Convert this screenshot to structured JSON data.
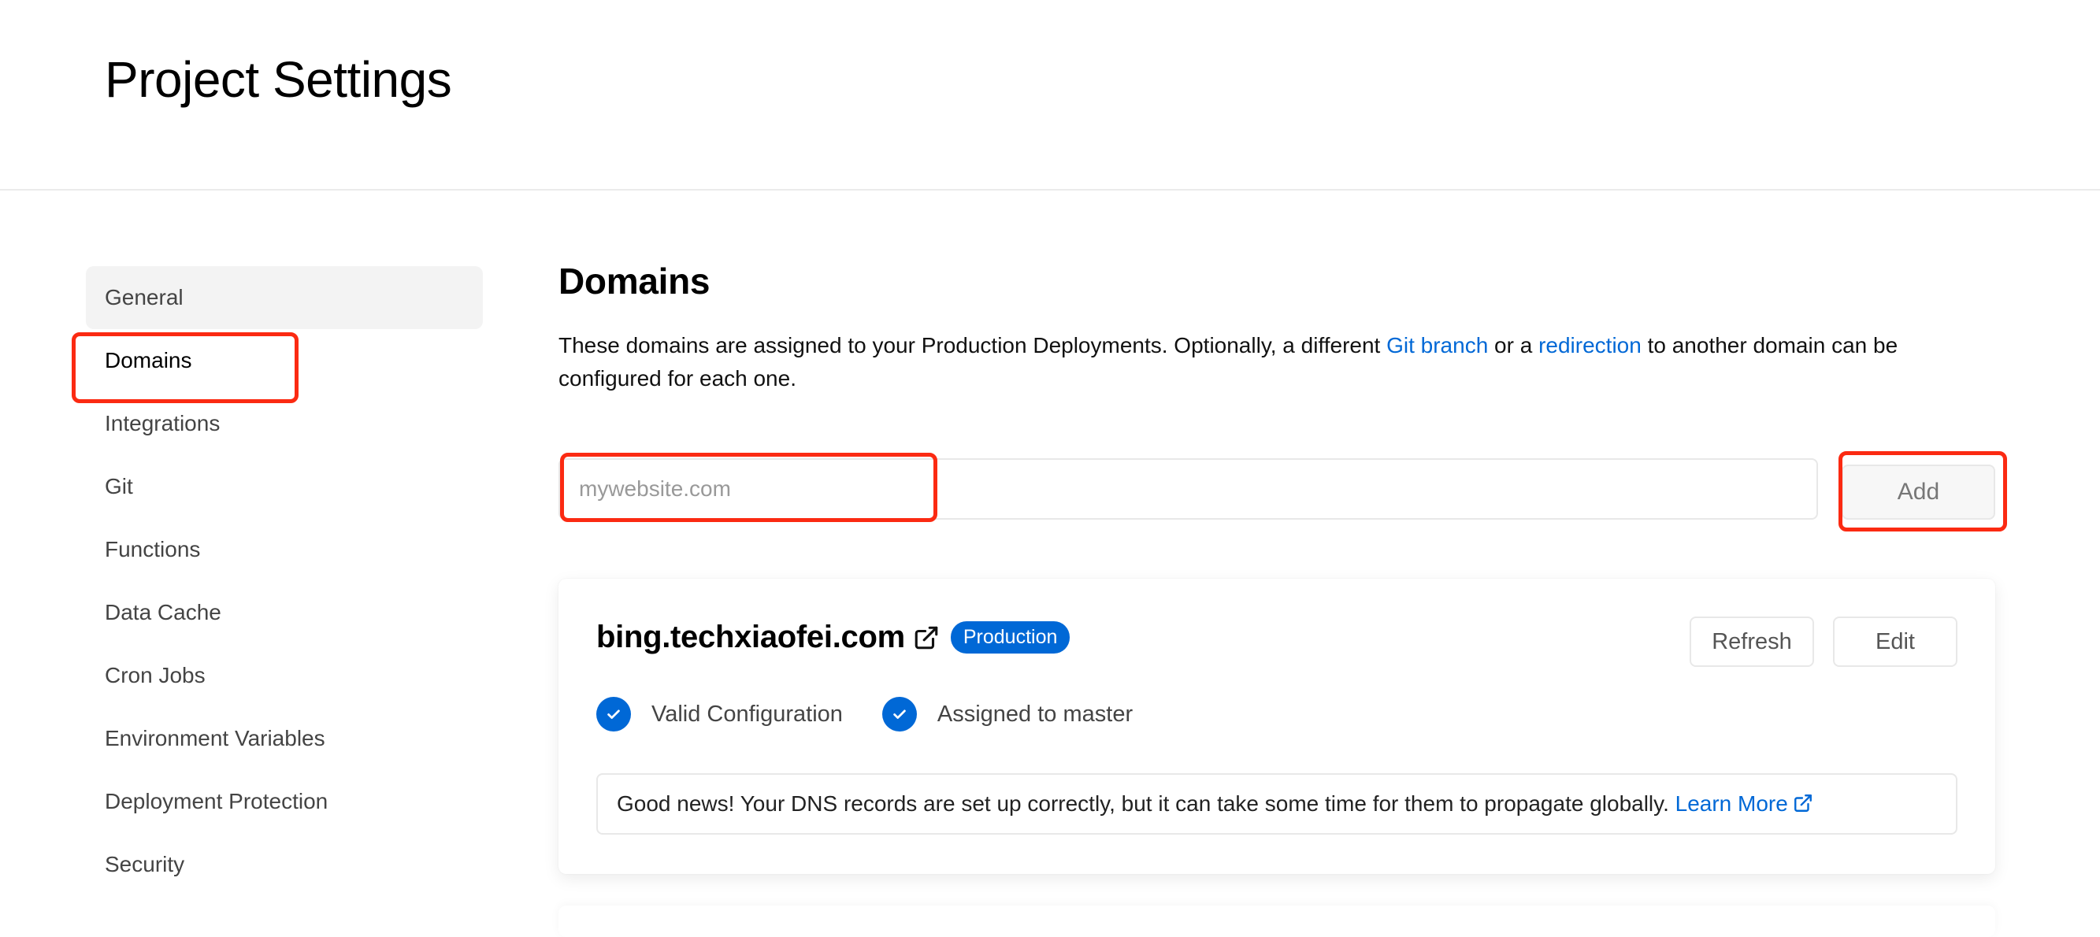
{
  "header": {
    "title": "Project Settings"
  },
  "sidebar": {
    "items": [
      {
        "label": "General",
        "hovered": true
      },
      {
        "label": "Domains",
        "active": true
      },
      {
        "label": "Integrations"
      },
      {
        "label": "Git"
      },
      {
        "label": "Functions"
      },
      {
        "label": "Data Cache"
      },
      {
        "label": "Cron Jobs"
      },
      {
        "label": "Environment Variables"
      },
      {
        "label": "Deployment Protection"
      },
      {
        "label": "Security"
      }
    ]
  },
  "main": {
    "title": "Domains",
    "description": {
      "part1": "These domains are assigned to your Production Deployments. Optionally, a different ",
      "link1": "Git branch",
      "part2": " or a ",
      "link2": "redirection",
      "part3": " to another domain can be configured for each one."
    },
    "domain_input": {
      "placeholder": "mywebsite.com",
      "value": ""
    },
    "add_button": "Add",
    "domains": [
      {
        "name": "bing.techxiaofei.com",
        "icon": "external-link-icon",
        "badge": "Production",
        "actions": {
          "refresh": "Refresh",
          "edit": "Edit"
        },
        "statuses": [
          {
            "icon": "check-circle-icon",
            "label": "Valid Configuration"
          },
          {
            "icon": "check-circle-icon",
            "label": "Assigned to master"
          }
        ],
        "notice": {
          "text": "Good news! Your DNS records are set up correctly, but it can take some time for them to propagate globally. ",
          "link": "Learn More",
          "link_icon": "external-link-icon"
        }
      }
    ]
  },
  "colors": {
    "accent": "#0068d6",
    "highlight": "#fb2a12",
    "border": "#e8e8e8",
    "hover_bg": "#f3f3f3"
  }
}
